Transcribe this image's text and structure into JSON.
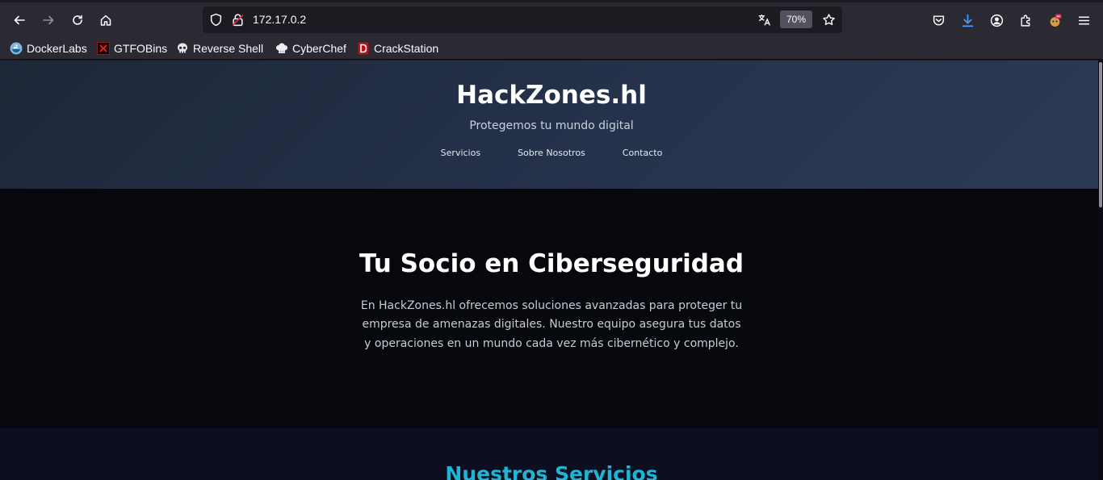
{
  "browser": {
    "url": "172.17.0.2",
    "zoom": "70%",
    "bookmarks": [
      {
        "label": "DockerLabs",
        "icon": "docker-icon"
      },
      {
        "label": "GTFOBins",
        "icon": "gtfobins-icon"
      },
      {
        "label": "Reverse Shell",
        "icon": "skull-icon"
      },
      {
        "label": "CyberChef",
        "icon": "chef-hat-icon"
      },
      {
        "label": "CrackStation",
        "icon": "crackstation-icon"
      }
    ]
  },
  "site": {
    "brand": "HackZones.hl",
    "tagline": "Protegemos tu mundo digital",
    "nav": [
      "Servicios",
      "Sobre Nosotros",
      "Contacto"
    ]
  },
  "hero": {
    "title": "Tu Socio en Ciberseguridad",
    "text": "En HackZones.hl ofrecemos soluciones avanzadas para proteger tu empresa de amenazas digitales. Nuestro equipo asegura tus datos y operaciones en un mundo cada vez más cibernético y complejo."
  },
  "services": {
    "title": "Nuestros Servicios"
  },
  "colors": {
    "accent": "#1fb6d4",
    "header_bg": "#26334d",
    "hero_bg": "#07080e",
    "chrome_bg": "#2b2a33"
  }
}
